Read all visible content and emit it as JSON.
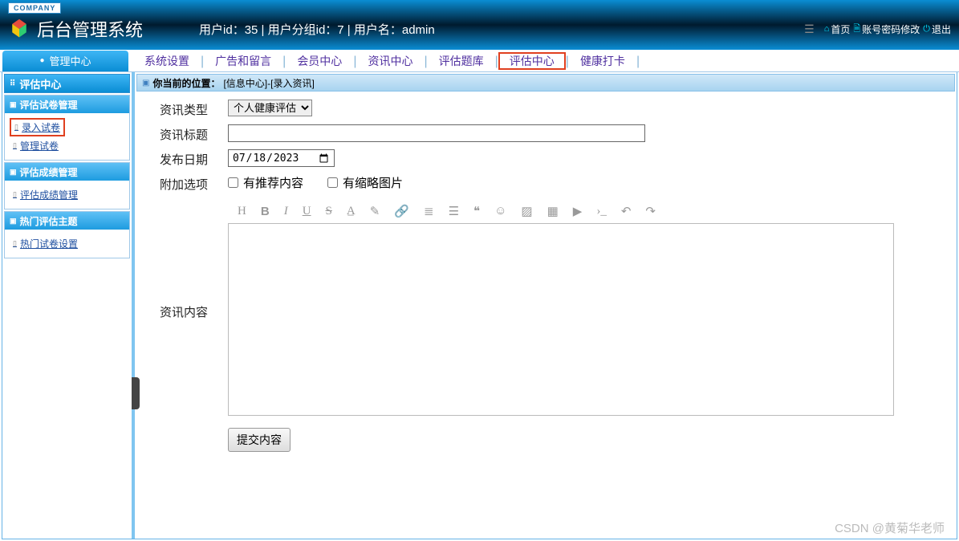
{
  "header": {
    "company_badge": "COMPANY",
    "title": "后台管理系统",
    "user_info": "用户id：35 | 用户分组id：7 | 用户名：admin",
    "home": "首页",
    "password": "账号密码修改",
    "logout": "退出"
  },
  "topnav": {
    "mgmt_tab": "管理中心",
    "items": [
      "系统设置",
      "广告和留言",
      "会员中心",
      "资讯中心",
      "评估题库",
      "评估中心",
      "健康打卡"
    ],
    "highlighted_index": 5
  },
  "sidebar": {
    "head": "评估中心",
    "boxes": [
      {
        "title": "评估试卷管理",
        "links": [
          "录入试卷",
          "管理试卷"
        ],
        "highlighted_index": 0
      },
      {
        "title": "评估成绩管理",
        "links": [
          "评估成绩管理"
        ]
      },
      {
        "title": "热门评估主题",
        "links": [
          "热门试卷设置"
        ]
      }
    ]
  },
  "breadcrumb": {
    "label": "你当前的位置：",
    "path": "[信息中心]-[录入资讯]"
  },
  "form": {
    "type_label": "资讯类型",
    "type_value": "个人健康评估",
    "title_label": "资讯标题",
    "title_value": "",
    "date_label": "发布日期",
    "date_value": "2023/07/18",
    "options_label": "附加选项",
    "opt_recommend": "有推荐内容",
    "opt_thumb": "有缩略图片",
    "content_label": "资讯内容",
    "submit": "提交内容"
  },
  "editor_toolbar": [
    "H",
    "B",
    "I",
    "U",
    "S",
    "A",
    "brush",
    "link",
    "ol",
    "ul",
    "quote",
    "smile",
    "image",
    "table",
    "video",
    "code",
    "undo",
    "redo"
  ],
  "watermark": "CSDN @黄菊华老师"
}
